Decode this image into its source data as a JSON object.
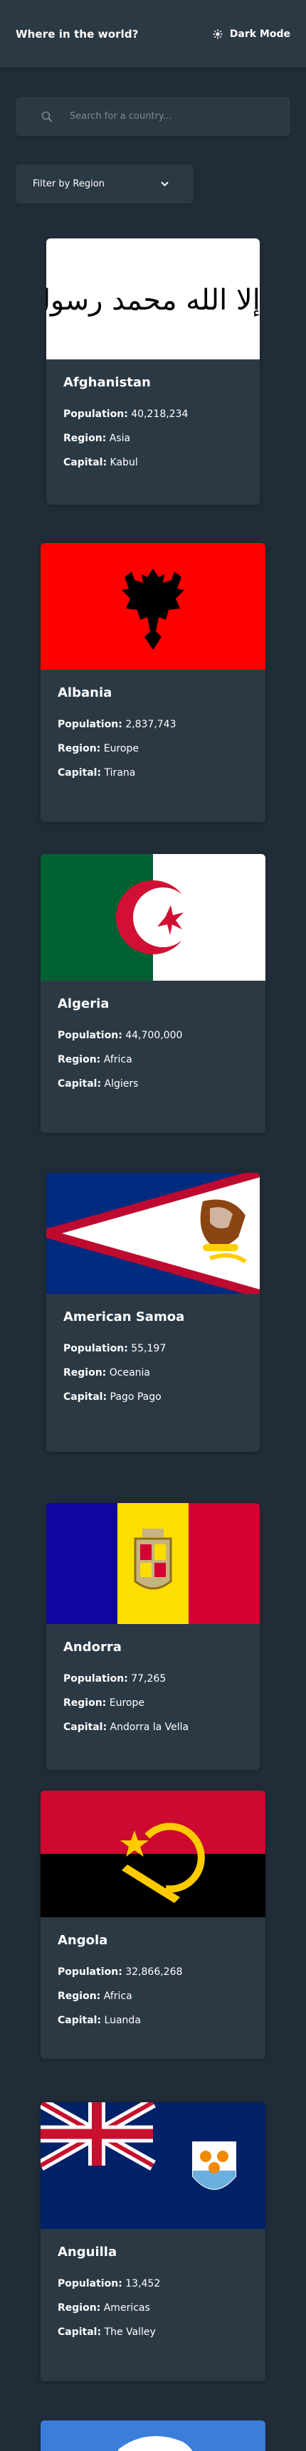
{
  "header": {
    "title": "Where in the world?",
    "mode_label": "Dark Mode"
  },
  "search": {
    "placeholder": "Search for a country..."
  },
  "filter": {
    "label": "Filter by Region"
  },
  "field_labels": {
    "population": "Population:",
    "region": "Region:",
    "capital": "Capital:"
  },
  "countries": [
    {
      "name": "Afghanistan",
      "population": "40,218,234",
      "region": "Asia",
      "capital": "Kabul",
      "flag_text": "لا إله إلا الله محمد رسول الله"
    },
    {
      "name": "Albania",
      "population": "2,837,743",
      "region": "Europe",
      "capital": "Tirana"
    },
    {
      "name": "Algeria",
      "population": "44,700,000",
      "region": "Africa",
      "capital": "Algiers"
    },
    {
      "name": "American Samoa",
      "population": "55,197",
      "region": "Oceania",
      "capital": "Pago Pago"
    },
    {
      "name": "Andorra",
      "population": "77,265",
      "region": "Europe",
      "capital": "Andorra la Vella"
    },
    {
      "name": "Angola",
      "population": "32,866,268",
      "region": "Africa",
      "capital": "Luanda"
    },
    {
      "name": "Anguilla",
      "population": "13,452",
      "region": "Americas",
      "capital": "The Valley"
    }
  ],
  "colors": {
    "background": "#202c37",
    "surface": "#2b3945",
    "text": "#ffffff",
    "placeholder": "#7d8791"
  }
}
